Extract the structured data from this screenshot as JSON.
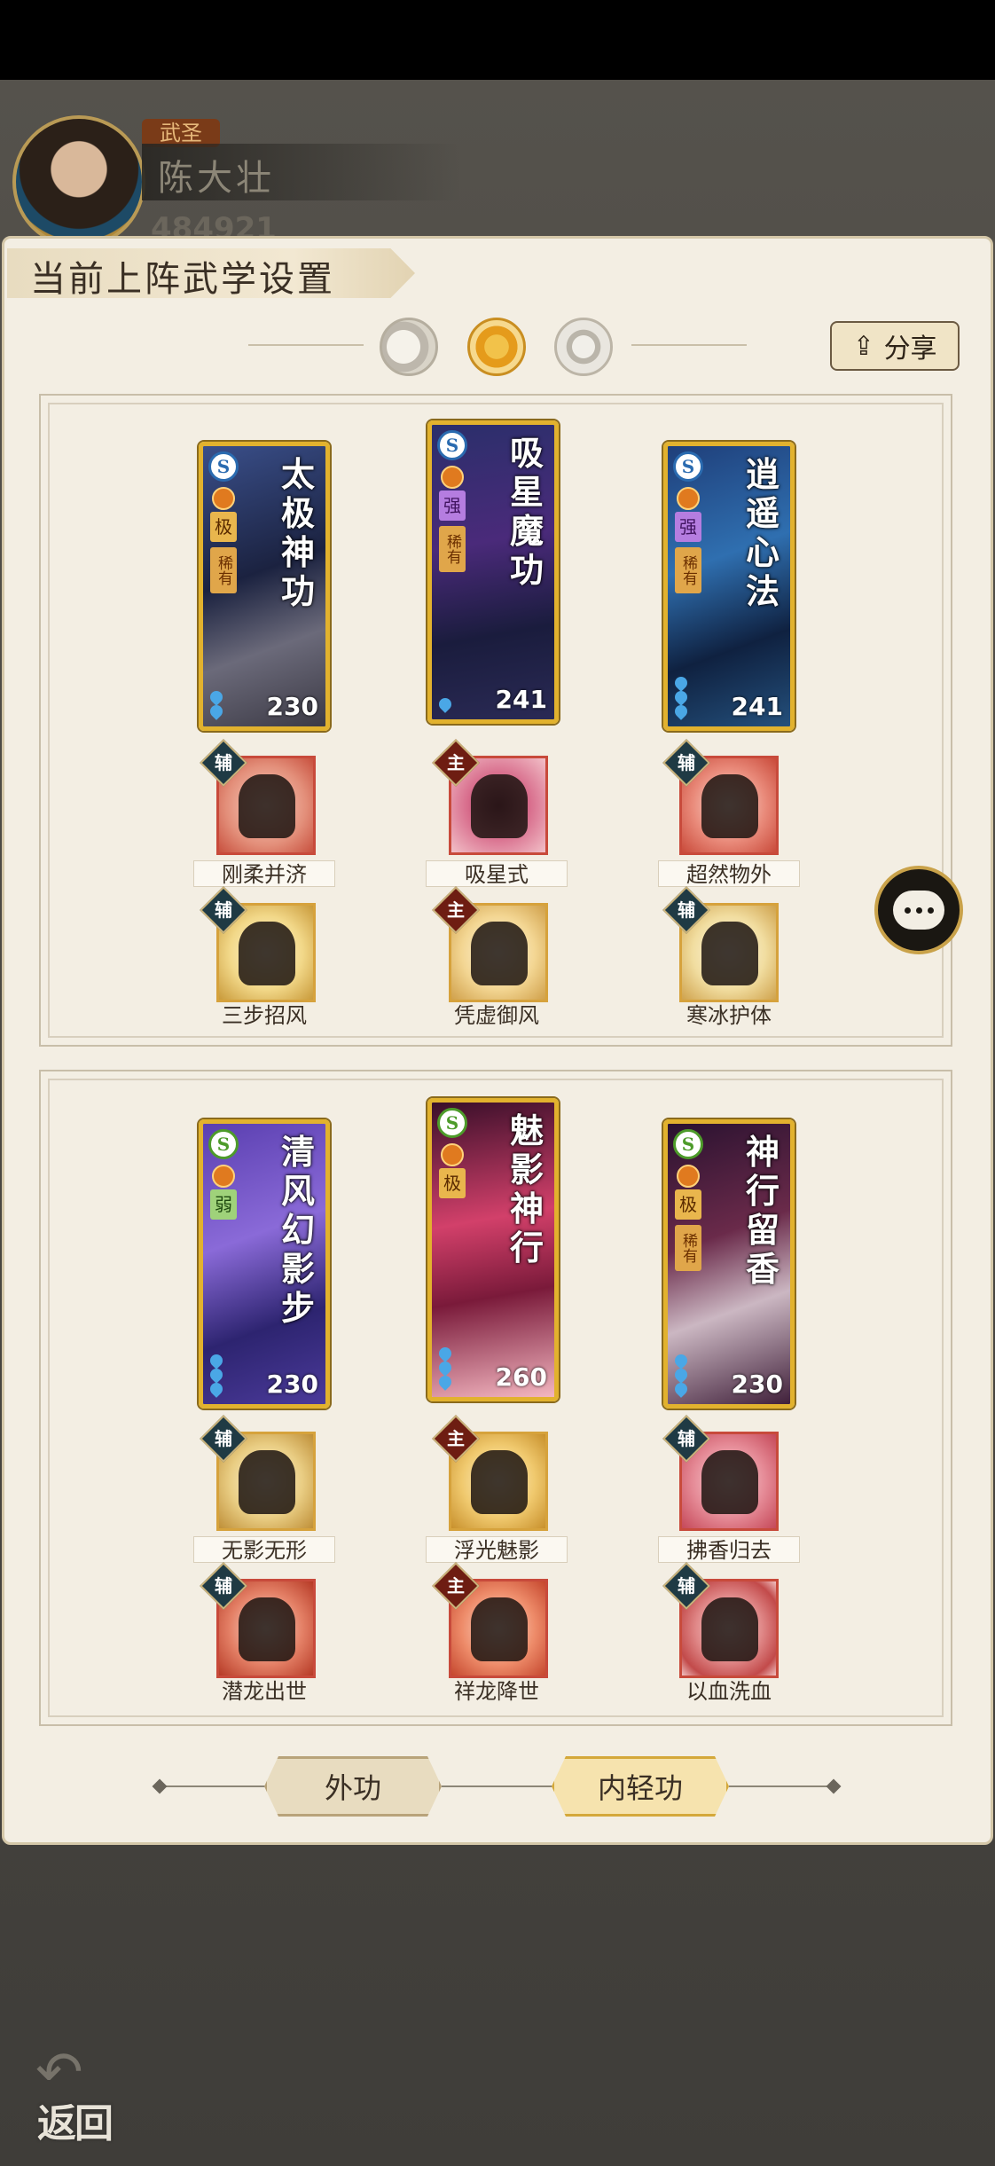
{
  "header": {
    "rank_tag": "武圣",
    "player_name": "陈大壮",
    "power_value": "484921"
  },
  "panel": {
    "title": "当前上阵武学设置",
    "share_label": "分享"
  },
  "groups": [
    {
      "cards": [
        {
          "name": "太极神功",
          "tier": "极",
          "rarity": "稀有",
          "score": "230"
        },
        {
          "name": "吸星魔功",
          "tier": "强",
          "rarity": "稀有",
          "score": "241"
        },
        {
          "name": "逍遥心法",
          "tier": "强",
          "rarity": "稀有",
          "score": "241"
        }
      ],
      "skills_row1": [
        {
          "tag": "辅",
          "label": "刚柔并济"
        },
        {
          "tag": "主",
          "label": "吸星式"
        },
        {
          "tag": "辅",
          "label": "超然物外"
        }
      ],
      "skills_row2": [
        {
          "tag": "辅",
          "label": "三步招风"
        },
        {
          "tag": "主",
          "label": "凭虚御风"
        },
        {
          "tag": "辅",
          "label": "寒冰护体"
        }
      ]
    },
    {
      "cards": [
        {
          "name": "清风幻影步",
          "tier": "弱",
          "rarity": "",
          "score": "230"
        },
        {
          "name": "魅影神行",
          "tier": "极",
          "rarity": "",
          "score": "260"
        },
        {
          "name": "神行留香",
          "tier": "极",
          "rarity": "稀有",
          "score": "230"
        }
      ],
      "skills_row1": [
        {
          "tag": "辅",
          "label": "无影无形"
        },
        {
          "tag": "主",
          "label": "浮光魅影"
        },
        {
          "tag": "辅",
          "label": "拂香归去"
        }
      ],
      "skills_row2": [
        {
          "tag": "辅",
          "label": "潜龙出世"
        },
        {
          "tag": "主",
          "label": "祥龙降世"
        },
        {
          "tag": "辅",
          "label": "以血洗血"
        }
      ]
    }
  ],
  "tabs": {
    "outer": "外功",
    "inner": "内轻功"
  },
  "back_label": "返回",
  "colors": {
    "gold_frame": "#e2b22e",
    "main_tag": "#6e1d12",
    "aux_tag": "#1f3a44",
    "panel_bg": "#f3eee3"
  },
  "icons": [
    "share-icon",
    "chat-icon",
    "back-arrow-icon",
    "moon-phase-icon",
    "sun-phase-icon"
  ]
}
